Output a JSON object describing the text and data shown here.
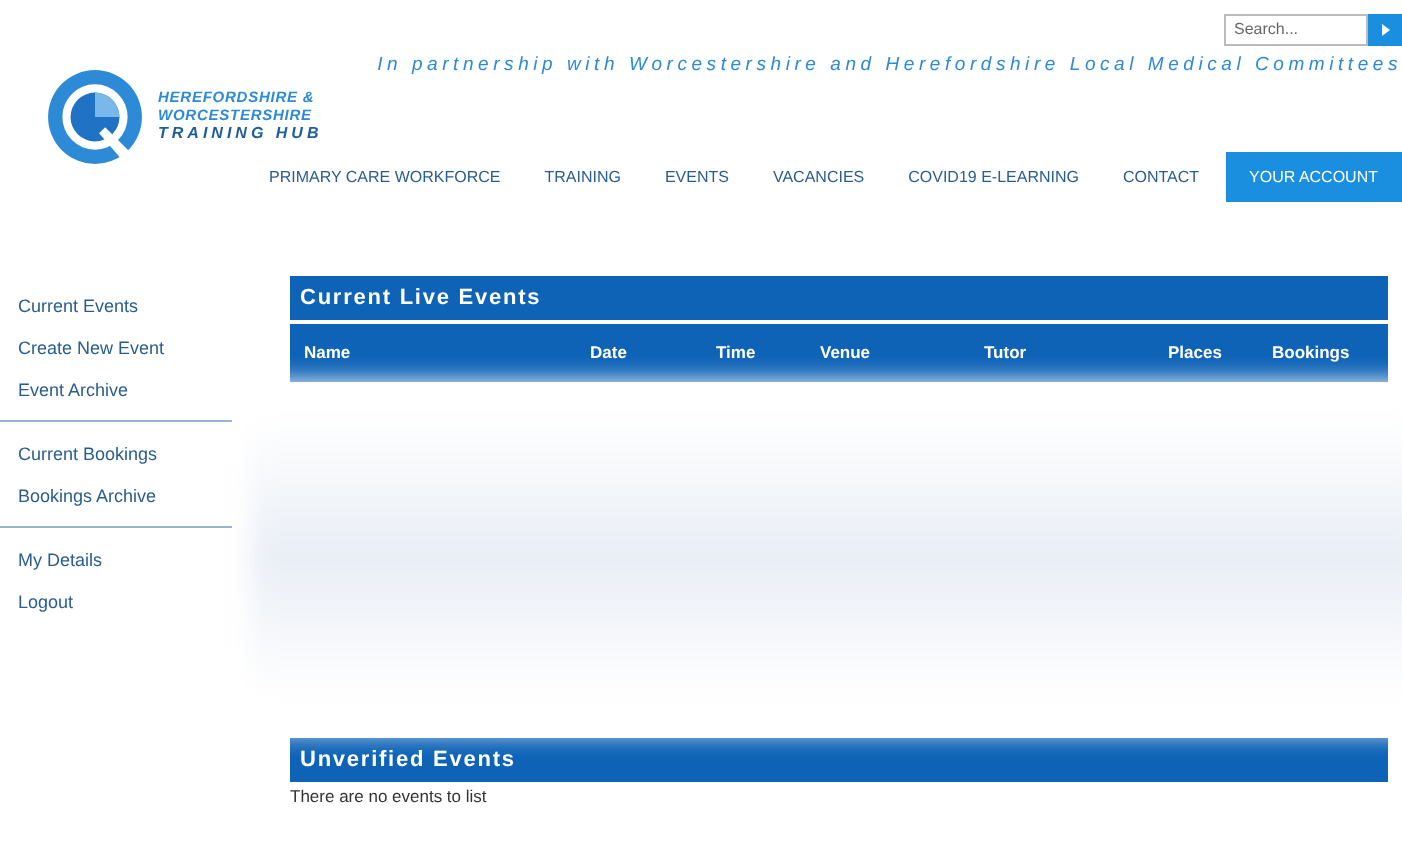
{
  "header": {
    "search": {
      "placeholder": "Search..."
    },
    "tagline": "In partnership with Worcestershire and Herefordshire Local Medical Committees",
    "logo_lines": [
      "HEREFORDSHIRE &",
      "WORCESTERSHIRE",
      "TRAINING HUB"
    ]
  },
  "nav": [
    {
      "label": "PRIMARY CARE WORKFORCE",
      "selected": false
    },
    {
      "label": "TRAINING",
      "selected": false
    },
    {
      "label": "EVENTS",
      "selected": false
    },
    {
      "label": "VACANCIES",
      "selected": false
    },
    {
      "label": "COVID19 E-LEARNING",
      "selected": false
    },
    {
      "label": "CONTACT",
      "selected": false
    },
    {
      "label": "YOUR ACCOUNT",
      "selected": true
    }
  ],
  "sidebar": {
    "groups": [
      [
        "Current Events",
        "Create New Event",
        "Event Archive"
      ],
      [
        "Current Bookings",
        "Bookings Archive"
      ],
      [
        "My Details",
        "Logout"
      ]
    ]
  },
  "live_events": {
    "title": "Current Live Events",
    "columns": [
      "Name",
      "Date",
      "Time",
      "Venue",
      "Tutor",
      "Places",
      "Bookings"
    ]
  },
  "unverified_events": {
    "title": "Unverified Events",
    "empty_text": "There are no events to list"
  }
}
